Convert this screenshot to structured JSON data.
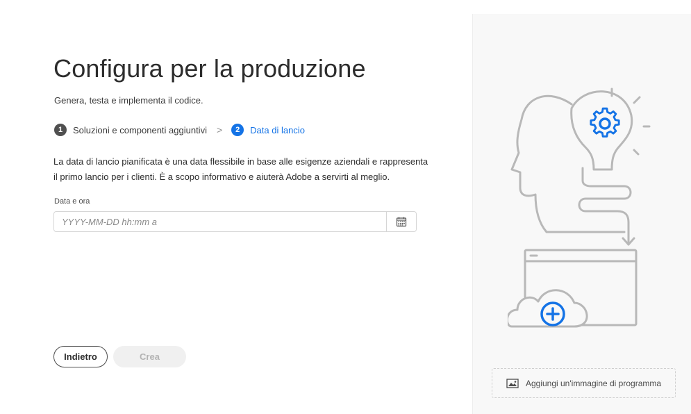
{
  "page": {
    "title": "Configura per la produzione",
    "subtitle": "Genera, testa e implementa il codice."
  },
  "stepper": {
    "steps": [
      {
        "number": "1",
        "label": "Soluzioni e componenti aggiuntivi",
        "state": "done"
      },
      {
        "number": "2",
        "label": "Data di lancio",
        "state": "active"
      }
    ],
    "separator": ">"
  },
  "description": "La data di lancio pianificata è una data flessibile in base alle esigenze aziendali e rappresenta il primo lancio per i clienti. È a scopo informativo e aiuterà Adobe a servirti al meglio.",
  "date_field": {
    "label": "Data e ora",
    "placeholder": "YYYY-MM-DD hh:mm a",
    "value": "",
    "icon": "calendar-icon"
  },
  "buttons": {
    "back_label": "Indietro",
    "create_label": "Crea"
  },
  "side_panel": {
    "illustration_icons": [
      "head-lightbulb-illustration",
      "gear-icon",
      "plus-circle-icon"
    ],
    "add_image_label": "Aggiungi un'immagine di programma",
    "add_image_icon": "image-icon"
  },
  "colors": {
    "accent": "#1473e6",
    "step_done": "#505050",
    "text": "#2c2c2c",
    "disabled_bg": "#f0f0f0",
    "disabled_text": "#b3b3b3",
    "illustration_stroke": "#b8b8b8"
  }
}
